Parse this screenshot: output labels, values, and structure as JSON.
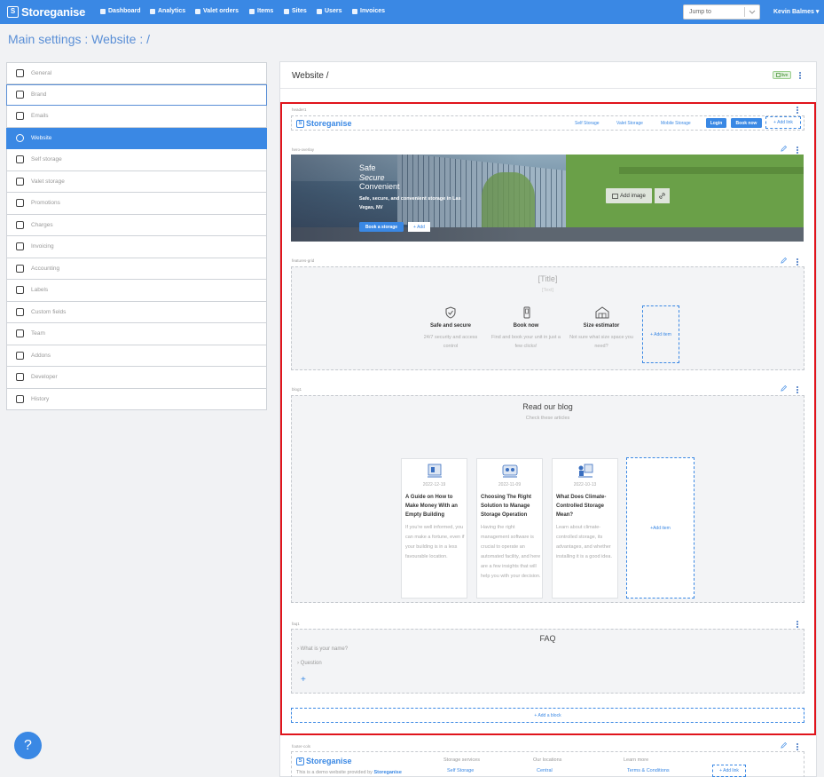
{
  "nav": {
    "brand": "Storeganise",
    "items": [
      "Dashboard",
      "Analytics",
      "Valet orders",
      "Items",
      "Sites",
      "Users",
      "Invoices"
    ],
    "jump_placeholder": "Jump to",
    "user": "Kevin Balmes"
  },
  "page_title": "Main settings : Website : /",
  "sidebar": {
    "items": [
      {
        "label": "General",
        "icon": "gear-icon"
      },
      {
        "label": "Brand",
        "icon": "image-icon"
      },
      {
        "label": "Emails",
        "icon": "envelope-icon"
      },
      {
        "label": "Website",
        "icon": "globe-icon"
      },
      {
        "label": "Self storage",
        "icon": "garage-icon"
      },
      {
        "label": "Valet storage",
        "icon": "box-icon"
      },
      {
        "label": "Promotions",
        "icon": "star-icon"
      },
      {
        "label": "Charges",
        "icon": "money-icon"
      },
      {
        "label": "Invoicing",
        "icon": "invoice-icon"
      },
      {
        "label": "Accounting",
        "icon": "ledger-icon"
      },
      {
        "label": "Labels",
        "icon": "tag-icon"
      },
      {
        "label": "Custom fields",
        "icon": "braces-icon"
      },
      {
        "label": "Team",
        "icon": "team-icon"
      },
      {
        "label": "Addons",
        "icon": "addons-icon"
      },
      {
        "label": "Developer",
        "icon": "code-icon"
      },
      {
        "label": "History",
        "icon": "history-icon"
      }
    ],
    "active": "Website"
  },
  "panel": {
    "title": "Website /",
    "live_badge": "live",
    "blocks": {
      "header": {
        "label": "header1",
        "logo": "Storeganise",
        "links": [
          "Self Storage",
          "Valet Storage",
          "Mobile Storage"
        ],
        "login": "Login",
        "book": "Book now",
        "add_link": "+ Add link"
      },
      "hero": {
        "label": "hero-overlay",
        "line1": "Safe",
        "line2": "Secure",
        "line3": "Convenient",
        "subtitle": "Safe, secure, and convenient storage in Las Vegas, NV",
        "book_btn": "Book a storage",
        "add_btn": "+ Add",
        "add_image": "Add image"
      },
      "features": {
        "label": "features-grid",
        "title": "[Title]",
        "subtitle": "[Text]",
        "items": [
          {
            "title": "Safe and secure",
            "text": "24/7 security and access control",
            "icon": "shield-check-icon"
          },
          {
            "title": "Book now",
            "text": "Find and book your unit in just a few clicks!",
            "icon": "phone-icon"
          },
          {
            "title": "Size estimator",
            "text": "Not sure what size space you need?",
            "icon": "boxes-icon"
          }
        ],
        "add_item": "+ Add item"
      },
      "blog": {
        "label": "blog1",
        "title": "Read our blog",
        "subtitle": "Check these articles",
        "cards": [
          {
            "date": "2022-12-19",
            "title": "A Guide on How to Make Money With an Empty Building",
            "text": "If you're well informed, you can make a fortune, even if your building is in a less favourable location."
          },
          {
            "date": "2022-11-09",
            "title": "Choosing The Right Solution to Manage Storage Operation",
            "text": "Having the right management software is crucial to operate an automated facility, and here are a few insights that will help you with your decision."
          },
          {
            "date": "2022-10-13",
            "title": "What Does Climate-Controlled Storage Mean?",
            "text": "Learn about climate-controlled storage, its advantages, and whether installing it is a good idea."
          }
        ],
        "add_item": "+Add item"
      },
      "faq": {
        "label": "faq1",
        "title": "FAQ",
        "questions": [
          "What is your name?",
          "Question"
        ],
        "add": "+"
      },
      "add_block": "+ Add a block",
      "footer": {
        "label": "footer-cols",
        "logo": "Storeganise",
        "demo_text": "This is a demo website provided by",
        "demo_link": "Storeganise",
        "col1_head": "Storage services",
        "col1_link": "Self Storage",
        "col2_head": "Our locations",
        "col2_link": "Central",
        "col3_head": "Learn more",
        "col3_link": "Terms & Conditions",
        "add_link": "+ Add link"
      }
    }
  },
  "help": "?"
}
